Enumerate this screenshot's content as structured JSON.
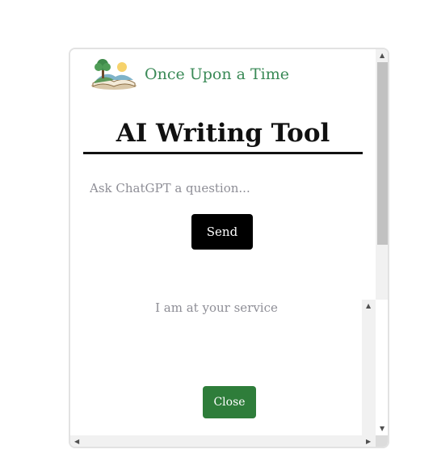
{
  "brand": {
    "name": "Once Upon a Time",
    "logo_icon": "open-book-landscape-icon"
  },
  "main": {
    "title": "AI Writing Tool",
    "question_placeholder": "Ask ChatGPT a question...",
    "question_value": "",
    "send_label": "Send",
    "response_text": "I am at your service",
    "close_label": "Close"
  },
  "colors": {
    "brand_text": "#3a8a57",
    "send_button": "#000000",
    "close_button": "#2e7d3a",
    "placeholder_text": "#8e8e96"
  }
}
